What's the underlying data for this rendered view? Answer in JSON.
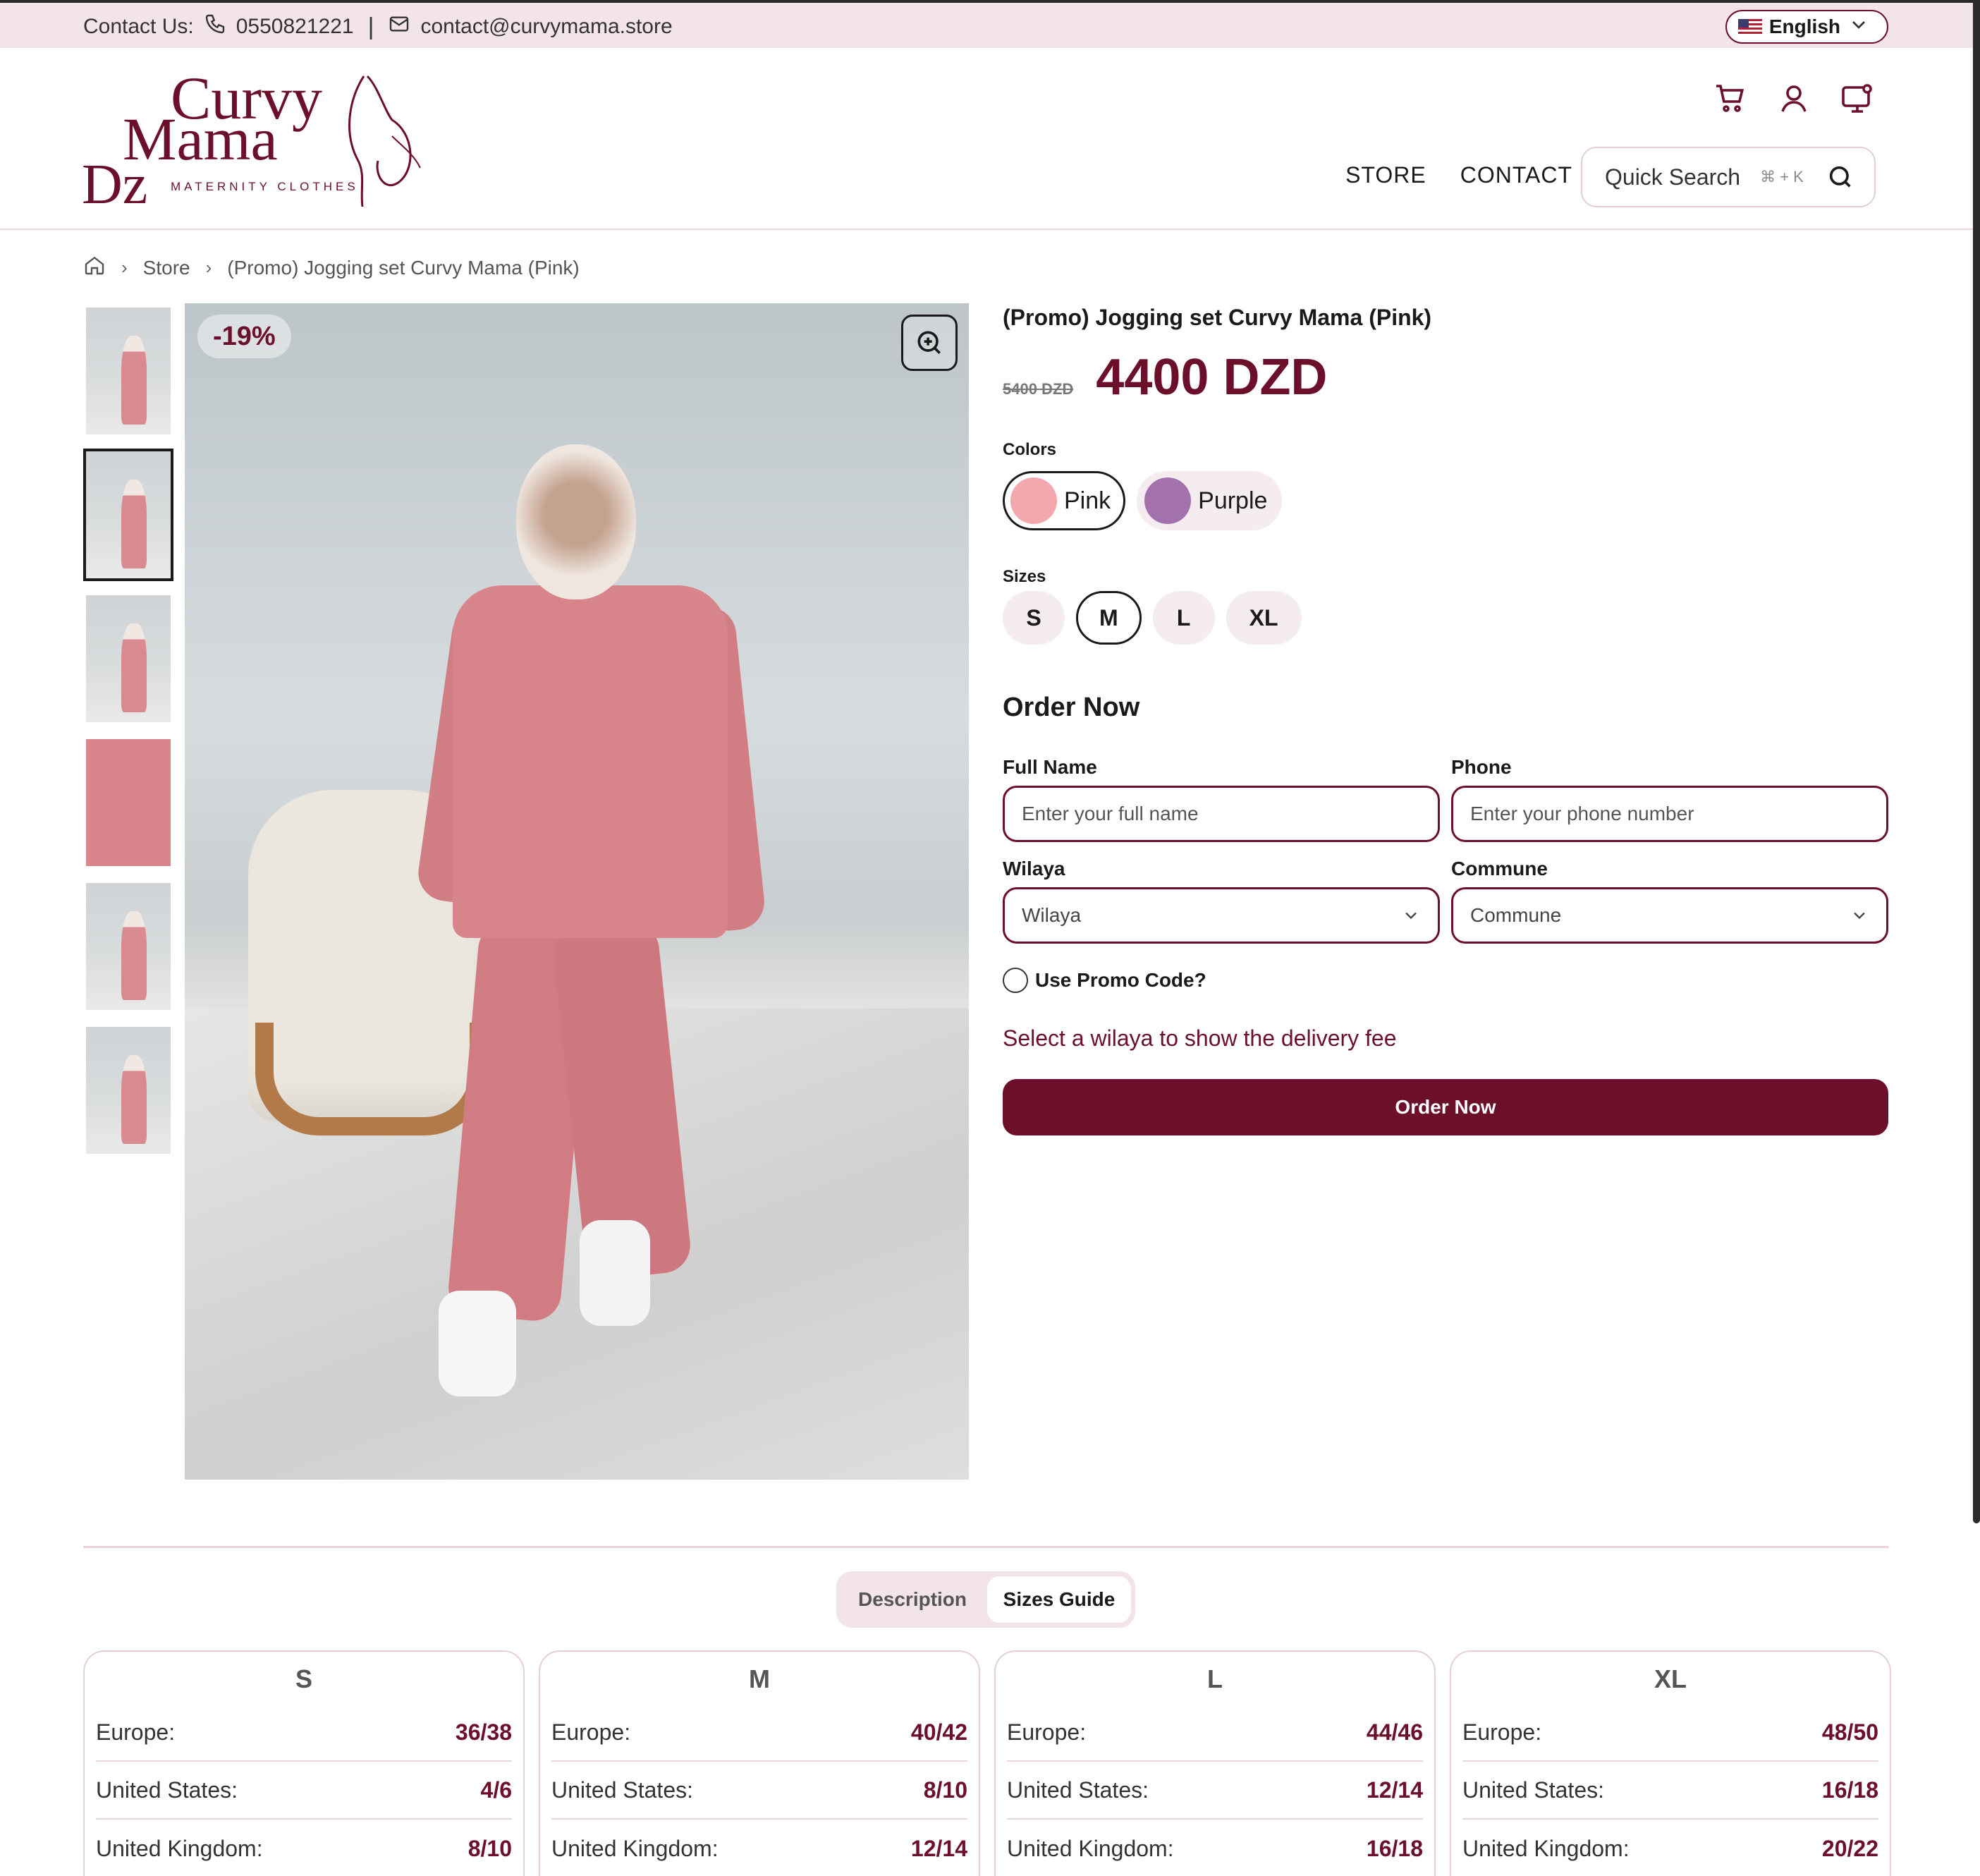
{
  "topbar": {
    "contact_label": "Contact Us:",
    "phone": "0550821221",
    "email": "contact@curvymama.store",
    "language": "English"
  },
  "header": {
    "logo_text_1": "Curvy",
    "logo_text_2": "Mama",
    "logo_text_3": "Dz",
    "logo_tagline": "MATERNITY CLOTHES",
    "nav": [
      "STORE",
      "CONTACT"
    ],
    "search_label": "Quick Search",
    "search_shortcut": "⌘ + K"
  },
  "breadcrumb": {
    "store": "Store",
    "current": "(Promo) Jogging set Curvy Mama (Pink)"
  },
  "gallery": {
    "discount": "-19%",
    "thumb_count": 6,
    "active_thumb": 2
  },
  "product": {
    "title": "(Promo) Jogging set Curvy Mama (Pink)",
    "old_price": "5400 DZD",
    "price": "4400 DZD",
    "colors_label": "Colors",
    "colors": [
      {
        "name": "Pink",
        "hex": "#f2a8ad",
        "selected": true
      },
      {
        "name": "Purple",
        "hex": "#a372ad",
        "selected": false
      }
    ],
    "sizes_label": "Sizes",
    "sizes": [
      "S",
      "M",
      "L",
      "XL"
    ],
    "selected_size": "M"
  },
  "order": {
    "heading": "Order Now",
    "full_name_label": "Full Name",
    "full_name_placeholder": "Enter your full name",
    "phone_label": "Phone",
    "phone_placeholder": "Enter your phone number",
    "wilaya_label": "Wilaya",
    "wilaya_value": "Wilaya",
    "commune_label": "Commune",
    "commune_value": "Commune",
    "promo_label": "Use Promo Code?",
    "delivery_note": "Select a wilaya to show the delivery fee",
    "button": "Order Now"
  },
  "tabs": {
    "description": "Description",
    "sizes_guide": "Sizes Guide",
    "active": "Sizes Guide"
  },
  "size_guide": {
    "rows": [
      "Europe:",
      "United States:",
      "United Kingdom:"
    ],
    "cards": [
      {
        "size": "S",
        "values": [
          "36/38",
          "4/6",
          "8/10"
        ]
      },
      {
        "size": "M",
        "values": [
          "40/42",
          "8/10",
          "12/14"
        ]
      },
      {
        "size": "L",
        "values": [
          "44/46",
          "12/14",
          "16/18"
        ]
      },
      {
        "size": "XL",
        "values": [
          "48/50",
          "16/18",
          "20/22"
        ]
      }
    ]
  },
  "colors": {
    "brand": "#6b0f2a",
    "topbar_bg": "#f3e3ea"
  }
}
